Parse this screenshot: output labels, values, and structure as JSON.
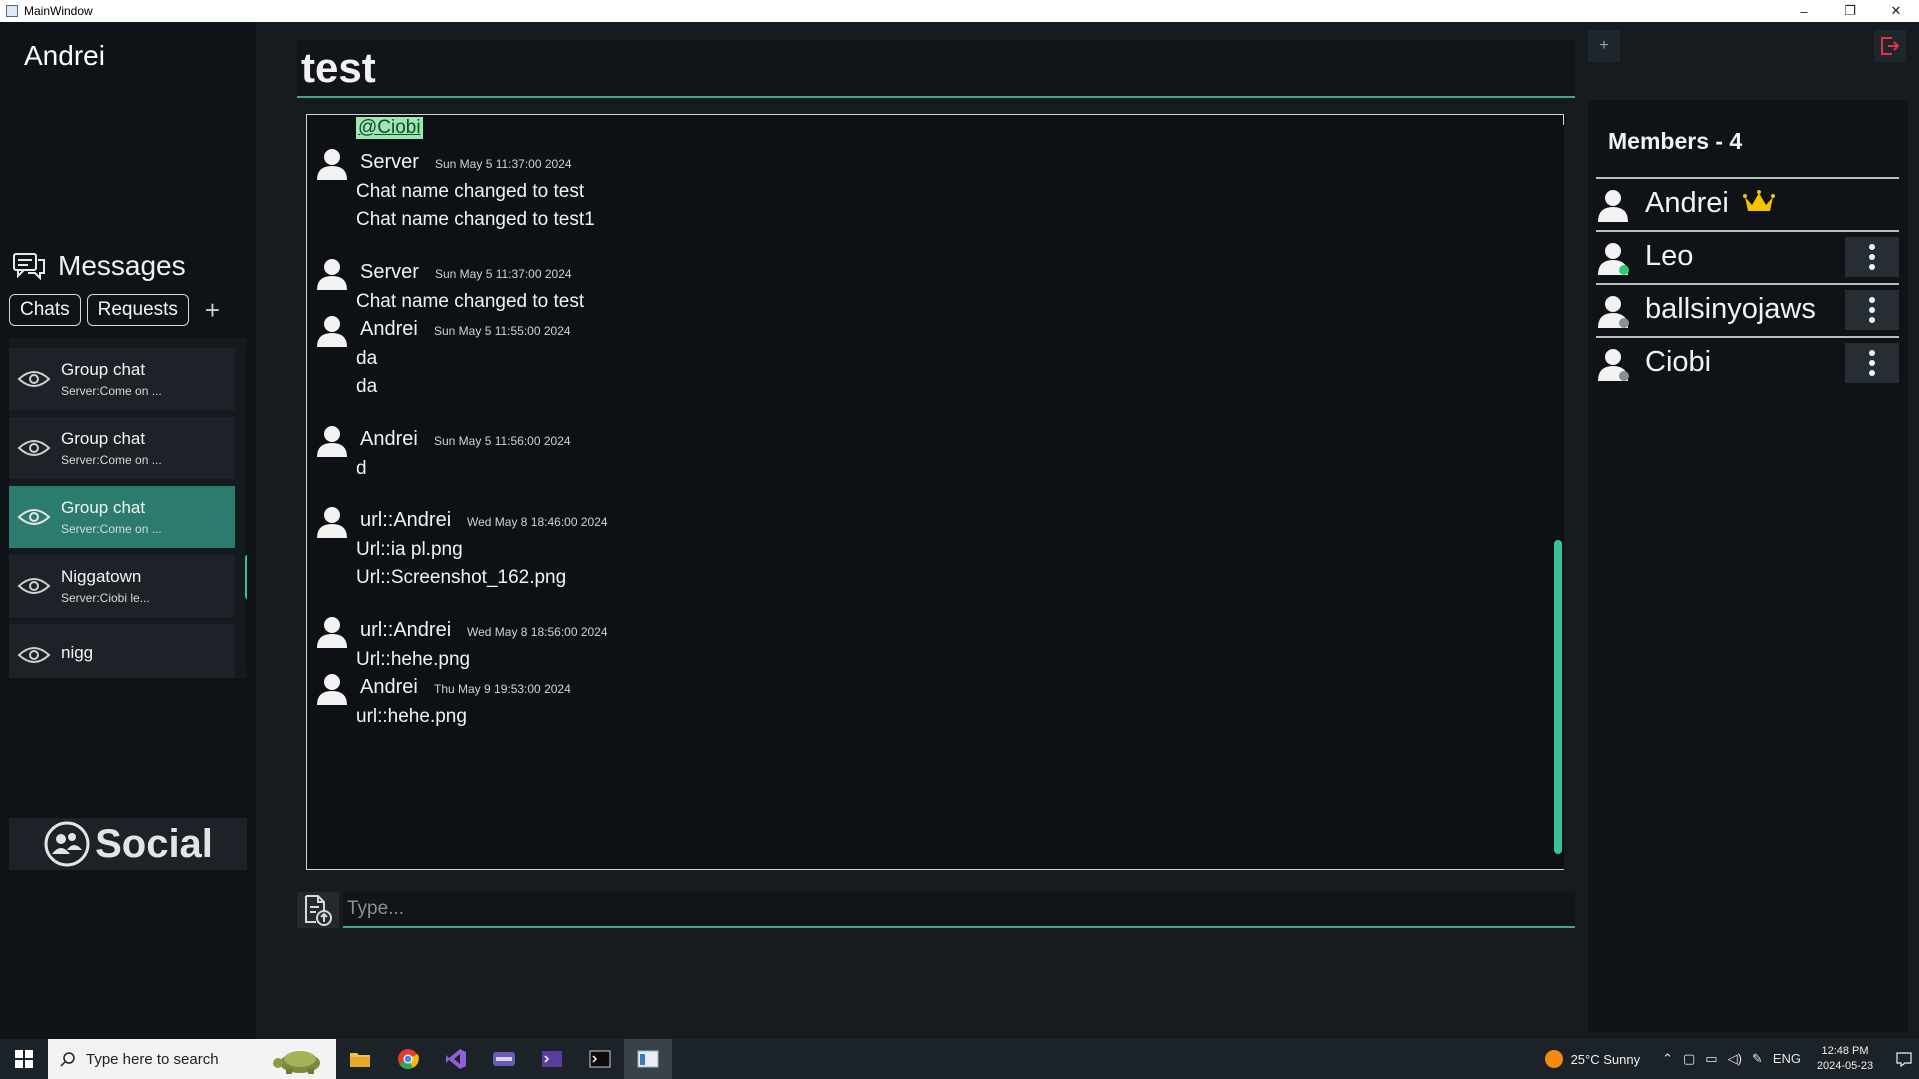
{
  "window": {
    "title": "MainWindow",
    "controls": [
      "–",
      "❐",
      "✕"
    ]
  },
  "sidebar": {
    "username": "Andrei",
    "messages_label": "Messages",
    "tabs": {
      "chats": "Chats",
      "requests": "Requests",
      "add": "+"
    },
    "chats": [
      {
        "name": "Group chat",
        "preview": "Server:Come on ..."
      },
      {
        "name": "Group chat",
        "preview": "Server:Come on ..."
      },
      {
        "name": "Group chat",
        "preview": "Server:Come on ...",
        "active": true
      },
      {
        "name": "Niggatown",
        "preview": "Server:Ciobi le..."
      },
      {
        "name": "nigg",
        "preview": ""
      }
    ],
    "social_label": "Social"
  },
  "chat": {
    "title": "test",
    "mention": "@Ciobi",
    "messages": [
      {
        "author": "Server",
        "timestamp": "Sun May 5 11:37:00 2024",
        "lines": [
          "Chat name changed to test",
          "Chat name changed to test1"
        ]
      },
      {
        "author": "Server",
        "timestamp": "Sun May 5 11:37:00 2024",
        "lines": [
          "Chat name changed to test"
        ]
      },
      {
        "author": "Andrei",
        "timestamp": "Sun May 5 11:55:00 2024",
        "lines": [
          "da",
          "da"
        ]
      },
      {
        "author": "Andrei",
        "timestamp": "Sun May 5 11:56:00 2024",
        "lines": [
          "d"
        ]
      },
      {
        "author": "url::Andrei",
        "timestamp": "Wed May 8 18:46:00 2024",
        "lines": [
          "Url::ia pl.png",
          "Url::Screenshot_162.png"
        ]
      },
      {
        "author": "url::Andrei",
        "timestamp": "Wed May 8 18:56:00 2024",
        "lines": [
          "Url::hehe.png"
        ]
      },
      {
        "author": "Andrei",
        "timestamp": "Thu May 9 19:53:00 2024",
        "lines": [
          "url::hehe.png"
        ]
      }
    ],
    "composer": {
      "placeholder": "Type..."
    }
  },
  "members": {
    "title": "Members - 4",
    "list": [
      {
        "name": "Andrei",
        "role": "owner",
        "status": "self"
      },
      {
        "name": "Leo",
        "status": "online"
      },
      {
        "name": "ballsinyojaws",
        "status": "offline"
      },
      {
        "name": "Ciobi",
        "status": "offline"
      }
    ],
    "add_label": "+"
  },
  "taskbar": {
    "search_placeholder": "Type here to search",
    "weather": "25°C  Sunny",
    "language": "ENG",
    "time": "12:48 PM",
    "date": "2024-05-23"
  },
  "colors": {
    "accent": "#39c19a",
    "active_chat": "#2b7c6e",
    "mention_bg": "#9de6b6",
    "exit": "#e0344a",
    "online": "#2ecc71",
    "crown": "#f5c400"
  }
}
